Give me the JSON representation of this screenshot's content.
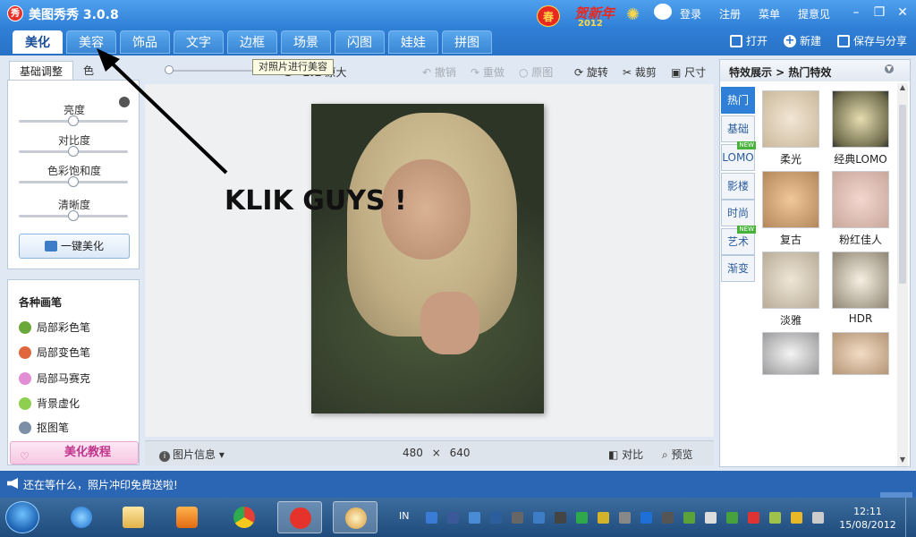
{
  "app": {
    "logo_glyph": "秀",
    "title": "美图秀秀 3.0.8",
    "greeting_char": "春",
    "greeting_text": "贺新年",
    "greeting_year": "2012",
    "top_links": [
      "登录",
      "注册",
      "菜单",
      "提意见"
    ]
  },
  "tabs": [
    "美化",
    "美容",
    "饰品",
    "文字",
    "边框",
    "场景",
    "闪图",
    "娃娃",
    "拼图"
  ],
  "tab_actions": {
    "open": "打开",
    "new": "新建",
    "save_share": "保存与分享"
  },
  "left_panel": {
    "tab_basic": "基础调整",
    "tab_color": "色",
    "sliders": [
      {
        "label": "亮度",
        "value": 0.5
      },
      {
        "label": "对比度",
        "value": 0.5
      },
      {
        "label": "色彩饱和度",
        "value": 0.5
      },
      {
        "label": "清晰度",
        "value": 0.5
      }
    ],
    "one_key": "一键美化",
    "brush_title": "各种画笔",
    "brushes": [
      "局部彩色笔",
      "局部变色笔",
      "局部马赛克",
      "背景虚化",
      "抠图笔"
    ],
    "tutorial": "美化教程"
  },
  "toolbar": {
    "tooltip": "对照片进行美容",
    "ratio": "1:1",
    "original_size": "原大",
    "undo": "撤销",
    "redo": "重做",
    "original": "原图",
    "rotate": "旋转",
    "crop": "裁剪",
    "size": "尺寸"
  },
  "annotation": "KLIK GUYS !",
  "canvas_bottom": {
    "info": "图片信息",
    "width": "480",
    "times": "×",
    "height": "640",
    "compare": "对比",
    "preview": "预览"
  },
  "right_panel": {
    "header": "特效展示 > 热门特效",
    "categories": [
      {
        "label": "热门",
        "active": true,
        "new": false
      },
      {
        "label": "基础",
        "active": false,
        "new": false
      },
      {
        "label": "LOMO",
        "active": false,
        "new": true
      },
      {
        "label": "影楼",
        "active": false,
        "new": false
      },
      {
        "label": "时尚",
        "active": false,
        "new": false
      },
      {
        "label": "艺术",
        "active": false,
        "new": true
      },
      {
        "label": "渐变",
        "active": false,
        "new": false
      }
    ],
    "new_badge": "NEW",
    "effects": [
      "柔光",
      "经典LOMO",
      "复古",
      "粉红佳人",
      "淡雅",
      "HDR"
    ]
  },
  "statusbar": {
    "message": "还在等什么，照片冲印免费送啦!"
  },
  "taskbar": {
    "input_lang": "IN",
    "time": "12:11",
    "date": "15/08/2012"
  }
}
